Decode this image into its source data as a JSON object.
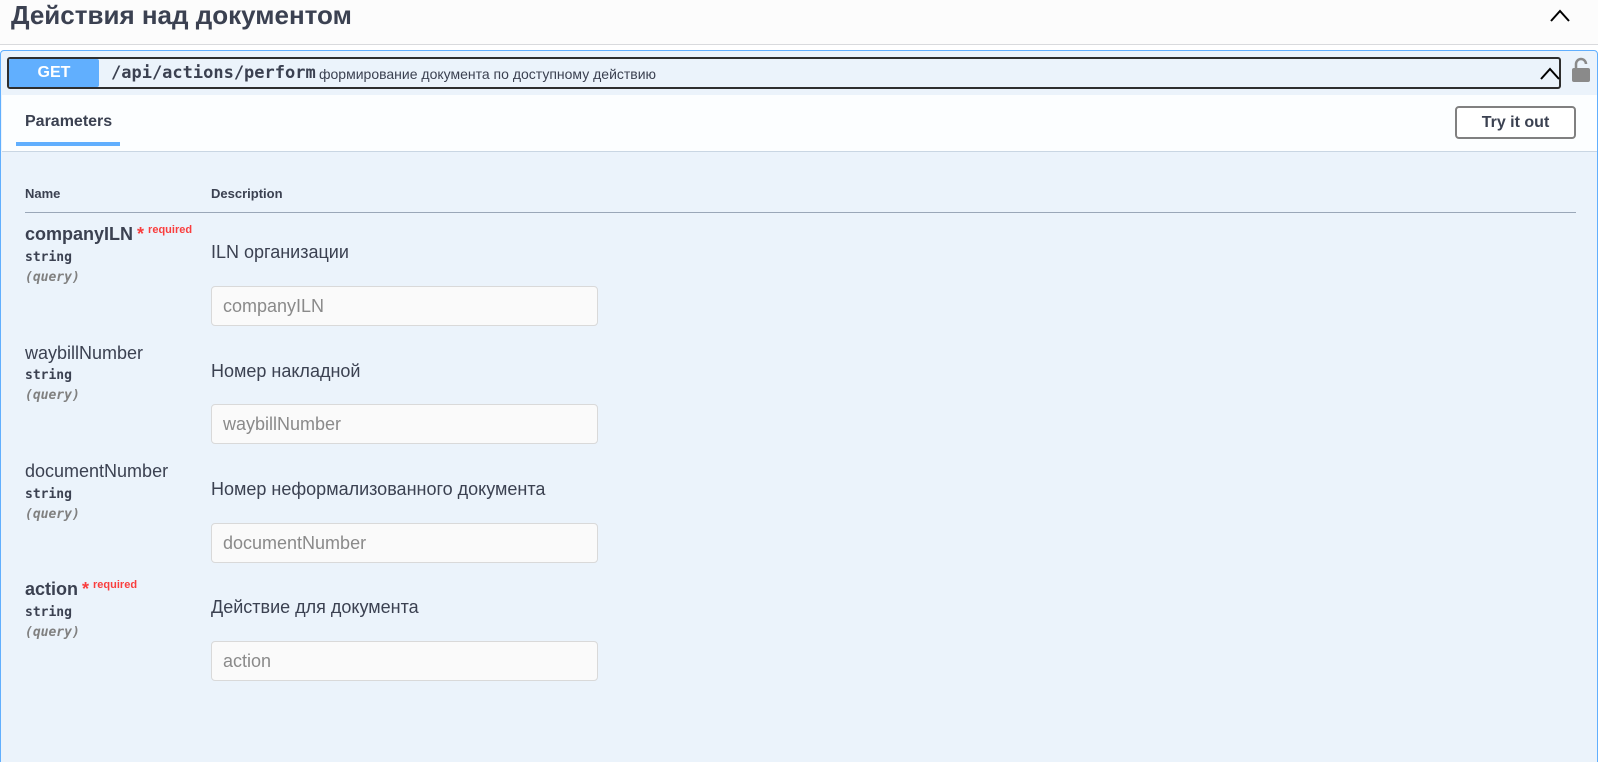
{
  "tag": {
    "title": "Действия над документом"
  },
  "operation": {
    "method": "GET",
    "path": "/api/actions/perform",
    "summary": "формирование документа по доступному действию"
  },
  "tabs": {
    "parameters": "Parameters"
  },
  "try_it_out": "Try it out",
  "table": {
    "name_header": "Name",
    "description_header": "Description"
  },
  "required_label": "required",
  "required_star": "*",
  "params": [
    {
      "name": "companyILN",
      "type": "string",
      "in": "(query)",
      "description": "ILN организации",
      "placeholder": "companyILN",
      "required": true
    },
    {
      "name": "waybillNumber",
      "type": "string",
      "in": "(query)",
      "description": "Номер накладной",
      "placeholder": "waybillNumber",
      "required": false
    },
    {
      "name": "documentNumber",
      "type": "string",
      "in": "(query)",
      "description": "Номер неформализованного документа",
      "placeholder": "documentNumber",
      "required": false
    },
    {
      "name": "action",
      "type": "string",
      "in": "(query)",
      "description": "Действие для документа",
      "placeholder": "action",
      "required": true
    }
  ],
  "colors": {
    "get": "#61affe",
    "required": "#f93e3e",
    "text": "#3b4151"
  },
  "icons": {
    "tag_toggle": "chevron-up-icon",
    "summary_toggle": "chevron-up-icon",
    "auth": "lock-icon"
  }
}
